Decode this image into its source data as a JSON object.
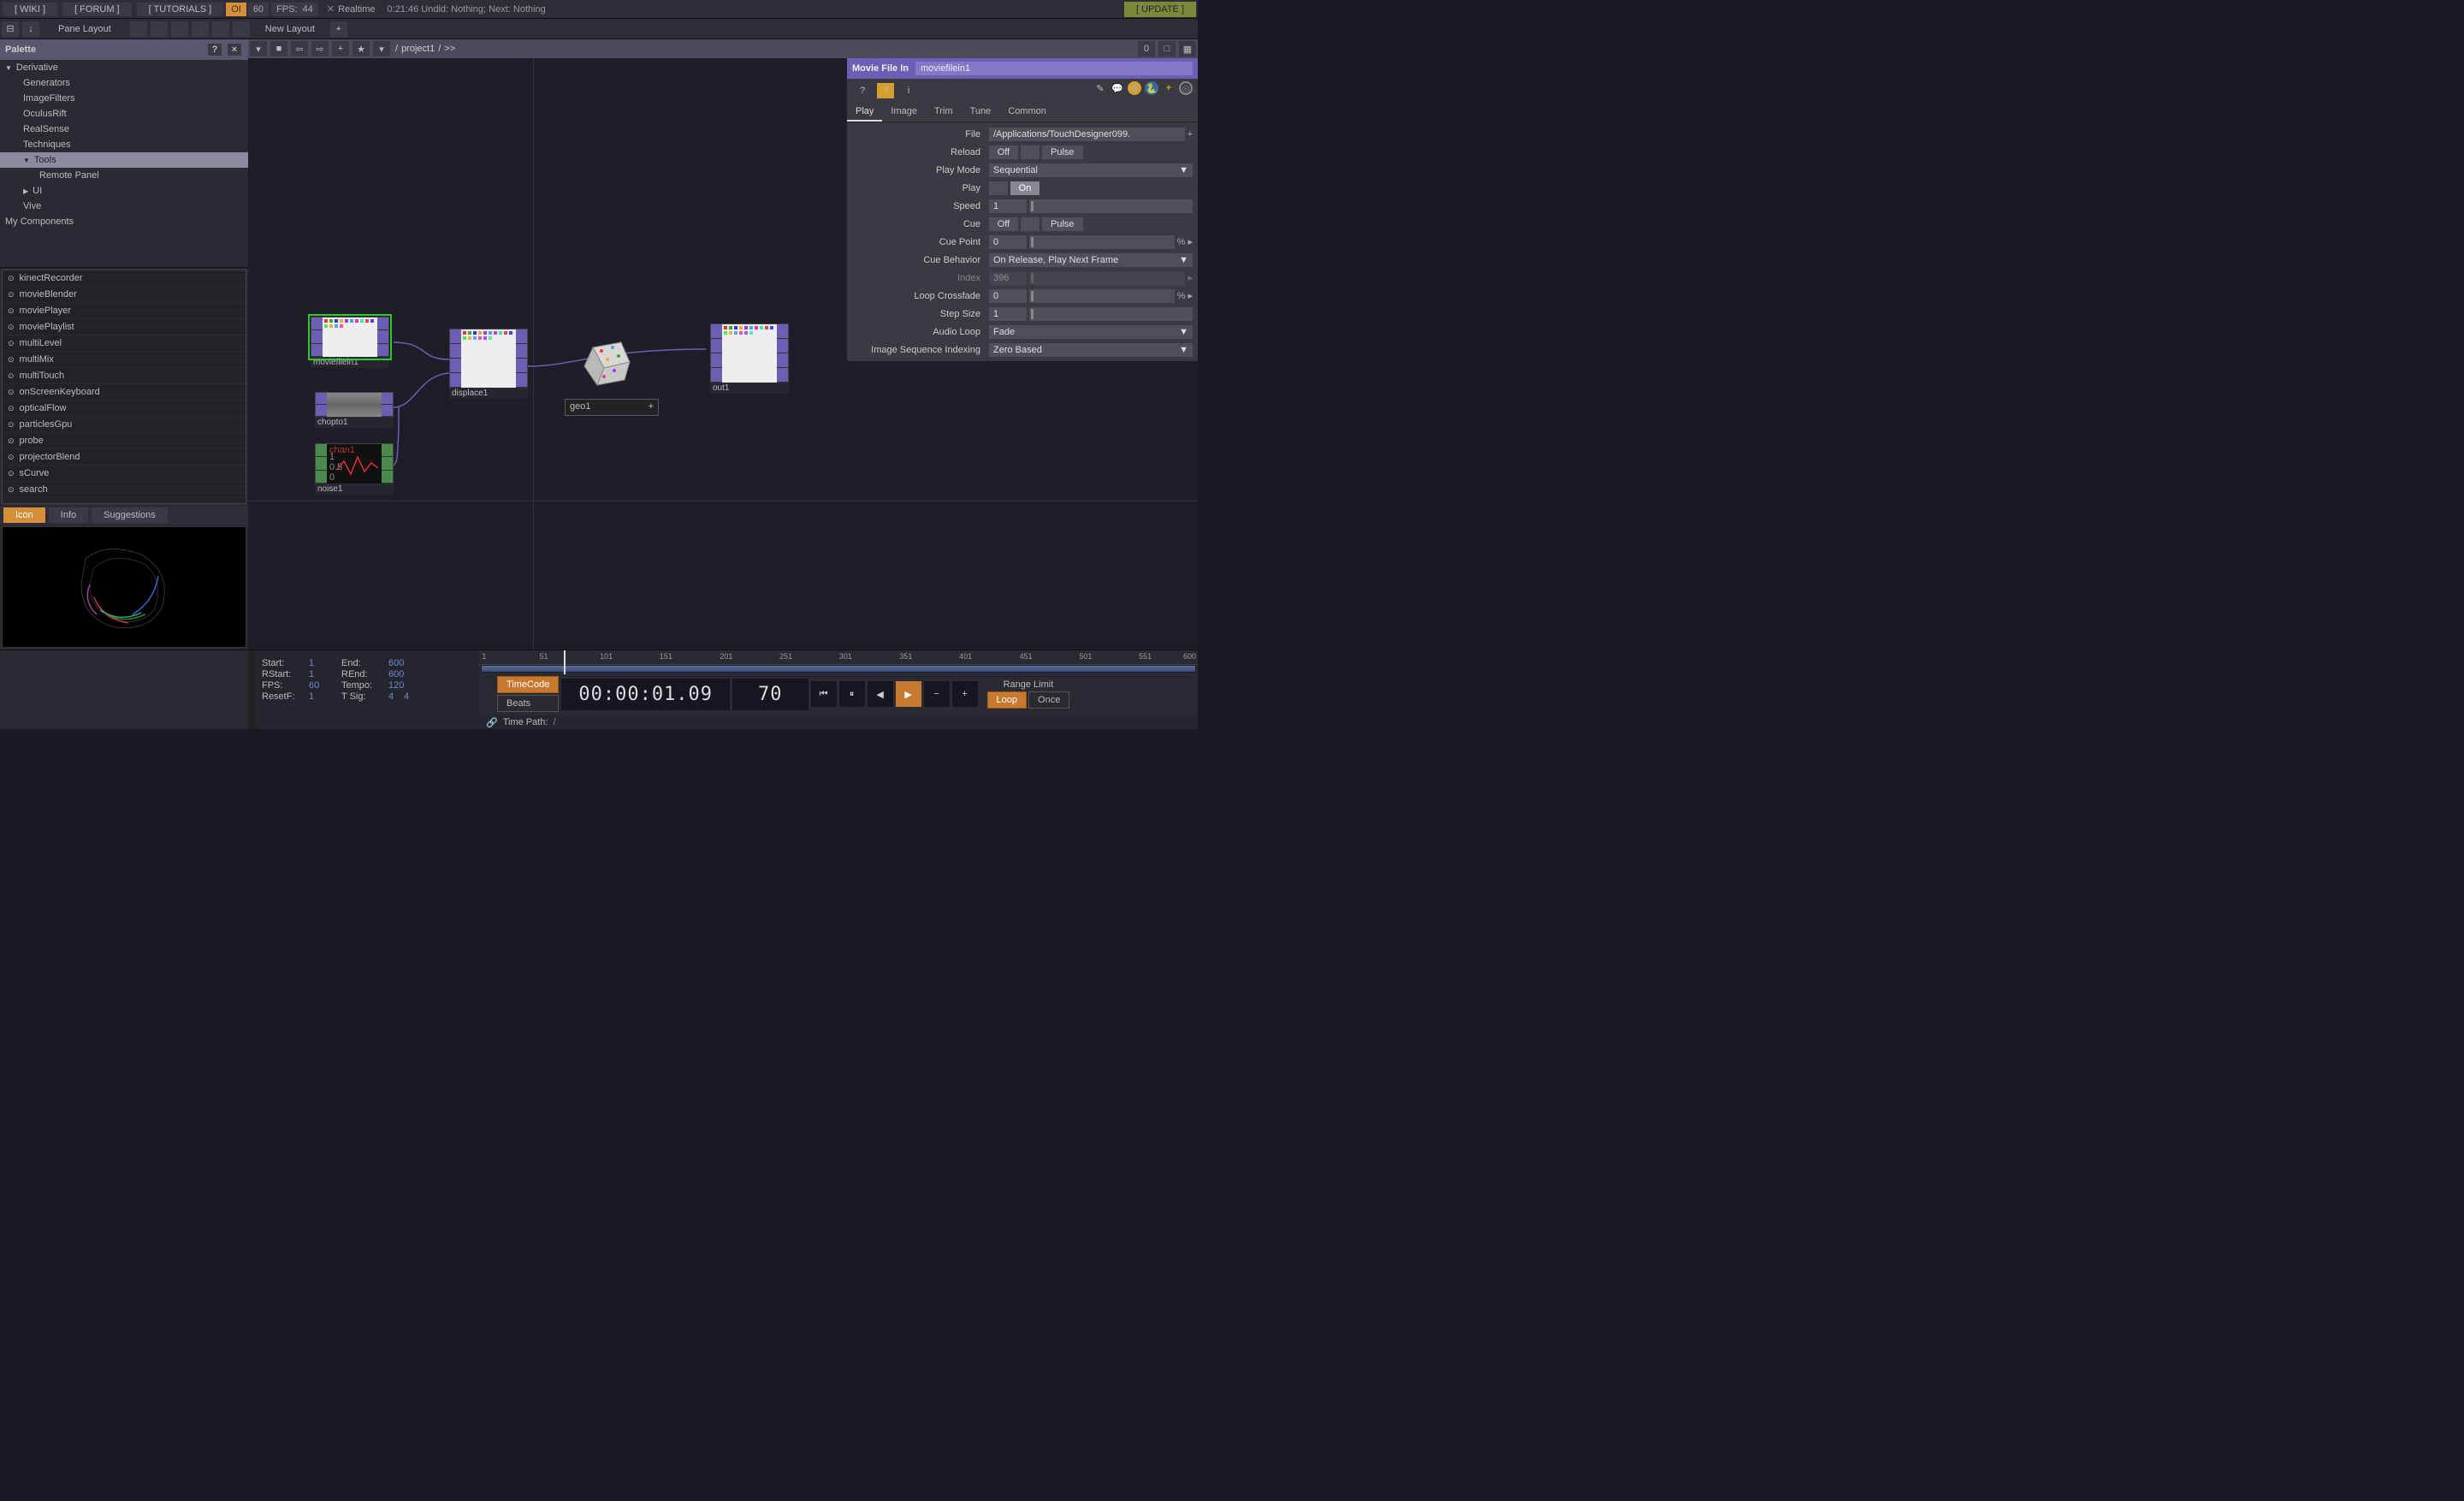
{
  "top": {
    "wiki": "[ WIKI ]",
    "forum": "[ FORUM ]",
    "tutorials": "[ TUTORIALS ]",
    "oi": "OI",
    "oi_num": "60",
    "fps_label": "FPS:",
    "fps_val": "44",
    "realtime": "Realtime",
    "status": "0:21:46 Undid: Nothing; Next: Nothing",
    "update": "[ UPDATE ]"
  },
  "pane": {
    "layout": "Pane Layout",
    "newlayout": "New Layout"
  },
  "palette": {
    "title": "Palette",
    "tree": {
      "derivative": "Derivative",
      "generators": "Generators",
      "imagefilters": "ImageFilters",
      "oculus": "OculusRift",
      "realsense": "RealSense",
      "techniques": "Techniques",
      "tools": "Tools",
      "remotepanel": "Remote Panel",
      "ui": "UI",
      "vive": "Vive",
      "mycomp": "My Components"
    },
    "comps": [
      "kinectRecorder",
      "movieBlender",
      "moviePlayer",
      "moviePlaylist",
      "multiLevel",
      "multiMix",
      "multiTouch",
      "onScreenKeyboard",
      "opticalFlow",
      "particlesGpu",
      "probe",
      "projectorBlend",
      "sCurve",
      "search"
    ],
    "tabs": {
      "icon": "Icon",
      "info": "Info",
      "sugg": "Suggestions"
    }
  },
  "path": {
    "root": "/",
    "proj": "project1",
    "tail": ">>"
  },
  "nodes": {
    "moviefilein1": "moviefilein1",
    "chopto1": "chopto1",
    "noise1": "noise1",
    "displace1": "displace1",
    "geo1": "geo1",
    "out1": "out1"
  },
  "params": {
    "optype": "Movie File In",
    "opname": "moviefilein1",
    "tabs": {
      "play": "Play",
      "image": "Image",
      "trim": "Trim",
      "tune": "Tune",
      "common": "Common"
    },
    "rows": {
      "file_l": "File",
      "file_v": "/Applications/TouchDesigner099.",
      "reload_l": "Reload",
      "reload_v": "Off",
      "pulse": "Pulse",
      "playmode_l": "Play Mode",
      "playmode_v": "Sequential",
      "play_l": "Play",
      "play_v": "On",
      "speed_l": "Speed",
      "speed_v": "1",
      "cue_l": "Cue",
      "cue_v": "Off",
      "cuepoint_l": "Cue Point",
      "cuepoint_v": "0",
      "pct": "%",
      "cuebhv_l": "Cue Behavior",
      "cuebhv_v": "On Release, Play Next Frame",
      "index_l": "Index",
      "index_v": "396",
      "loopx_l": "Loop Crossfade",
      "loopx_v": "0",
      "step_l": "Step Size",
      "step_v": "1",
      "audio_l": "Audio Loop",
      "audio_v": "Fade",
      "seq_l": "Image Sequence Indexing",
      "seq_v": "Zero Based"
    }
  },
  "time": {
    "start_l": "Start:",
    "start_v": "1",
    "end_l": "End:",
    "end_v": "600",
    "rstart_l": "RStart:",
    "rstart_v": "1",
    "rend_l": "REnd:",
    "rend_v": "600",
    "fps_l": "FPS:",
    "fps_v": "60",
    "tempo_l": "Tempo:",
    "tempo_v": "120",
    "resetf_l": "ResetF:",
    "resetf_v": "1",
    "tsig_l": "T Sig:",
    "tsig_v1": "4",
    "tsig_v2": "4",
    "ticks": [
      "1",
      "51",
      "101",
      "151",
      "201",
      "251",
      "301",
      "351",
      "401",
      "451",
      "501",
      "551",
      "600"
    ],
    "timecode_btn": "TimeCode",
    "beats_btn": "Beats",
    "tc": "00:00:01.09",
    "frame": "70",
    "range_l": "Range Limit",
    "loop": "Loop",
    "once": "Once",
    "timepath_l": "Time Path:",
    "timepath_v": "/"
  }
}
